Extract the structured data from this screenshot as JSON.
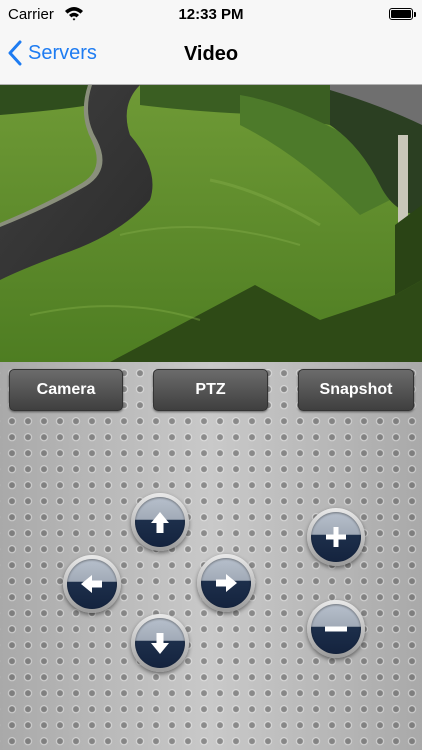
{
  "status_bar": {
    "carrier": "Carrier",
    "time": "12:33 PM"
  },
  "nav": {
    "back_label": "Servers",
    "title": "Video"
  },
  "tabs": {
    "camera": "Camera",
    "ptz": "PTZ",
    "snapshot": "Snapshot"
  },
  "ptz_controls": {
    "pan_tilt": [
      "up",
      "left",
      "right",
      "down"
    ],
    "zoom": [
      "in",
      "out"
    ]
  },
  "colors": {
    "accent": "#1e7cf2",
    "button_dark": "#4a4a4a",
    "arrow_button_bottom": "#14233e"
  }
}
